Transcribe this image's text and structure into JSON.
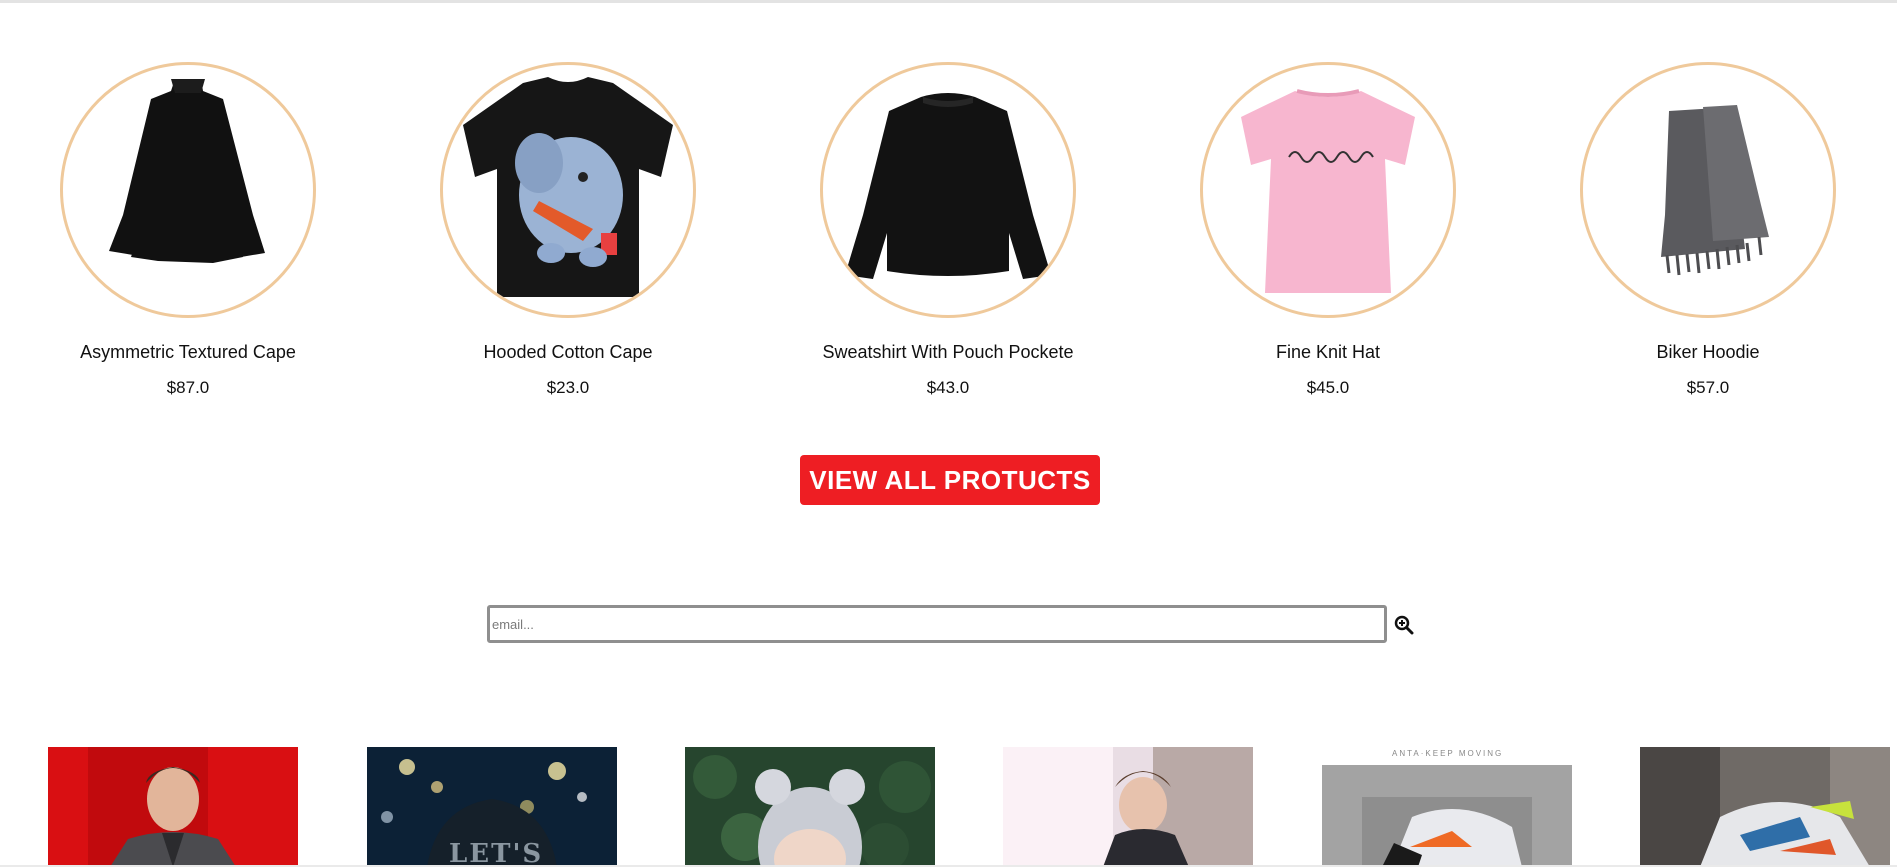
{
  "products": [
    {
      "name": "Asymmetric Textured Cape",
      "price": "$87.0"
    },
    {
      "name": "Hooded Cotton Cape",
      "price": "$23.0"
    },
    {
      "name": "Sweatshirt With Pouch Pockete",
      "price": "$43.0"
    },
    {
      "name": "Fine Knit Hat",
      "price": "$45.0"
    },
    {
      "name": "Biker Hoodie",
      "price": "$57.0"
    }
  ],
  "view_all": {
    "label": "VIEW ALL PROTUCTS"
  },
  "newsletter": {
    "placeholder": "email...",
    "icon": "zoom-in-icon"
  },
  "gallery": {
    "thumbs": [
      {
        "alt_label": "LET'S"
      },
      {
        "alt_label": "ANTA·KEEP MOVING"
      }
    ]
  },
  "colors": {
    "accent": "#ee1e23",
    "circle_border": "#efc99b"
  }
}
